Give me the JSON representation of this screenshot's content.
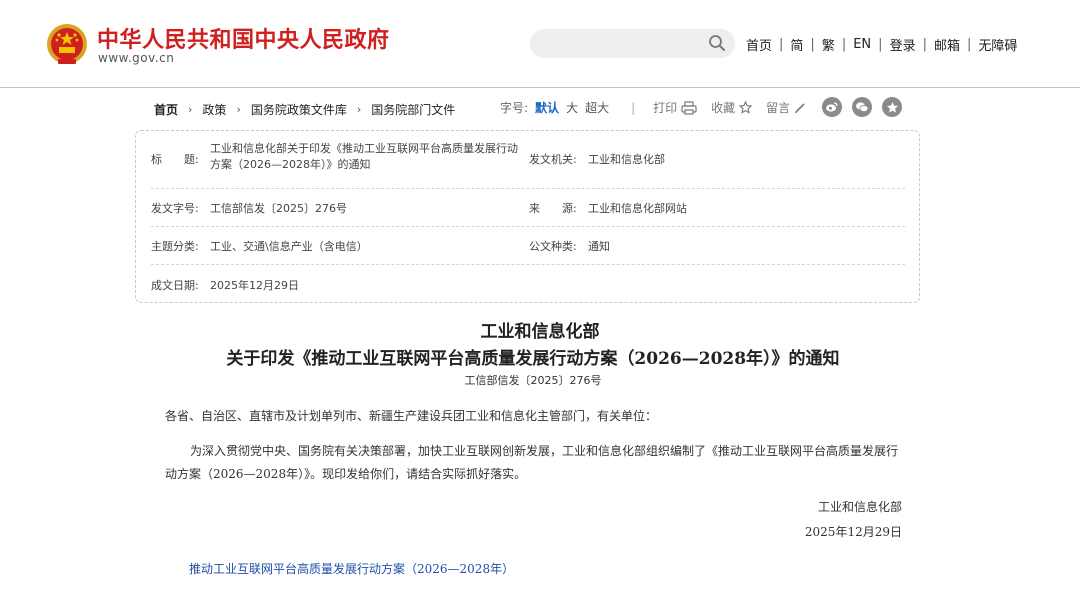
{
  "header": {
    "site_title": "中华人民共和国中央人民政府",
    "site_url": "www.gov.cn",
    "nav_links": [
      "首页",
      "简",
      "繁",
      "EN",
      "登录",
      "邮箱",
      "无障碍"
    ]
  },
  "breadcrumb": [
    "首页",
    "政策",
    "国务院政策文件库",
    "国务院部门文件"
  ],
  "toolbar": {
    "font_size_label": "字号:",
    "font_sizes": [
      "默认",
      "大",
      "超大"
    ],
    "separator": "|",
    "print": "打印",
    "favorite": "收藏",
    "comment": "留言"
  },
  "metadata": {
    "title_label": "标　　题:",
    "title_value": "工业和信息化部关于印发《推动工业互联网平台高质量发展行动方案（2026—2028年）》的通知",
    "issuer_label": "发文机关:",
    "issuer_value": "工业和信息化部",
    "doc_no_label": "发文字号:",
    "doc_no_value": "工信部信发〔2025〕276号",
    "source_label": "来　　源:",
    "source_value": "工业和信息化部网站",
    "category_label": "主题分类:",
    "category_value": "工业、交通\\信息产业（含电信）",
    "doc_type_label": "公文种类:",
    "doc_type_value": "通知",
    "date_label": "成文日期:",
    "date_value": "2025年12月29日"
  },
  "article": {
    "title_line1": "工业和信息化部",
    "title_line2": "关于印发《推动工业互联网平台高质量发展行动方案（2026—2028年）》的通知",
    "doc_number": "工信部信发〔2025〕276号",
    "addressee": "各省、自治区、直辖市及计划单列市、新疆生产建设兵团工业和信息化主管部门，有关单位：",
    "paragraph": "为深入贯彻党中央、国务院有关决策部署，加快工业互联网创新发展，工业和信息化部组织编制了《推动工业互联网平台高质量发展行动方案（2026—2028年）》。现印发给你们，请结合实际抓好落实。",
    "signature_org": "工业和信息化部",
    "signature_date": "2025年12月29日",
    "attachment_link": "推动工业互联网平台高质量发展行动方案（2026—2028年）"
  },
  "colors": {
    "brand_red": "#d01f1f",
    "link_blue": "#1f4fa8",
    "active_blue": "#1a66c0"
  },
  "icons": {
    "emblem": "national-emblem-icon",
    "search": "search-icon",
    "print": "printer-icon",
    "favorite": "star-icon",
    "comment": "pencil-icon",
    "share": [
      "weibo-icon",
      "wechat-icon",
      "qzone-star-icon"
    ]
  }
}
